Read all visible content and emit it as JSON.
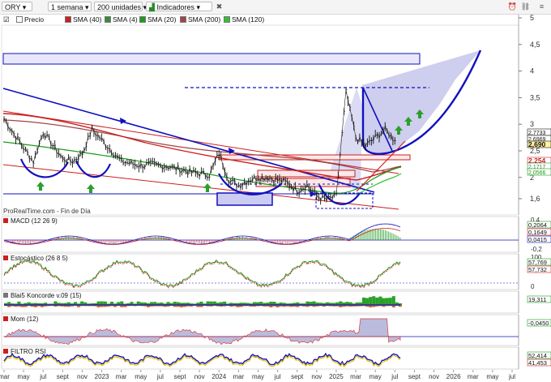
{
  "toolbar": {
    "ticker": "ORY",
    "timeframe": "1 semana",
    "units": "200 unidades",
    "indicators_btn": "Indicadores"
  },
  "legend": {
    "items": [
      "Precio",
      "SMA (40)",
      "SMA (4)",
      "SMA (20)",
      "SMA (200)",
      "SMA (120)"
    ]
  },
  "colors": {
    "price": "#111111",
    "sma40": "#cc1f1f",
    "sma4": "#3a8a3a",
    "sma20": "#1a9c1a",
    "sma200": "#a04646",
    "sma120": "#35c035",
    "trend_blue": "#1010c0",
    "cup_fill": "#b8b8e6"
  },
  "main": {
    "source_label": "ProRealTime.com - Fin de Día",
    "y_ticks": [
      "5",
      "4,5",
      "4",
      "3,5",
      "3",
      "2,5",
      "2",
      "1,6"
    ],
    "price_tags": [
      {
        "value": "2,7733",
        "color": "#111111"
      },
      {
        "value": "2,6969",
        "color": "#111111"
      },
      {
        "value": "2,690",
        "color": "#111111"
      },
      {
        "value": "2,254",
        "color": "#cc1f1f"
      },
      {
        "value": "2,1717",
        "color": "#3a8a3a"
      },
      {
        "value": "2,0566",
        "color": "#1a9c1a"
      }
    ]
  },
  "chart_data": [
    {
      "type": "line",
      "title": "ORY",
      "x_range": [
        "2022-03",
        "2026-07"
      ],
      "ylim": [
        1.5,
        5.1
      ],
      "grid": false,
      "series": [
        {
          "name": "Precio",
          "x": [
            "2022-03",
            "2022-05",
            "2022-06",
            "2022-07",
            "2022-08",
            "2022-09",
            "2022-10",
            "2022-11",
            "2022-12",
            "2023-01",
            "2023-03",
            "2023-05",
            "2023-06",
            "2023-08",
            "2023-10",
            "2023-12",
            "2024-01",
            "2024-02",
            "2024-03",
            "2024-04",
            "2024-05",
            "2024-06",
            "2024-07",
            "2024-08",
            "2024-09",
            "2024-10",
            "2024-11",
            "2024-12",
            "2025-01",
            "2025-02",
            "2025-03",
            "2025-04",
            "2025-05",
            "2025-06",
            "2025-07"
          ],
          "values": [
            3.1,
            2.55,
            2.3,
            2.85,
            2.6,
            2.35,
            2.3,
            2.45,
            2.9,
            2.7,
            2.3,
            2.22,
            2.25,
            2.2,
            2.1,
            2.05,
            2.45,
            1.95,
            1.85,
            1.95,
            2.0,
            2.0,
            1.95,
            1.9,
            1.75,
            1.85,
            1.65,
            1.58,
            1.65,
            3.6,
            2.75,
            2.6,
            2.75,
            2.9,
            2.69
          ]
        }
      ]
    },
    {
      "type": "bar",
      "title": "MACD (12 26 9)",
      "ylim": [
        -0.2,
        0.4
      ],
      "y_ticks": [
        "0,4",
        "-0,2"
      ],
      "tags": [
        "0,2064",
        "0,1649",
        "0,0415"
      ]
    },
    {
      "type": "line",
      "title": "Estocástico (26 8 5)",
      "ylim": [
        0,
        100
      ],
      "y_ticks": [
        "100",
        "0"
      ],
      "tags": [
        "57,769",
        "57,732"
      ]
    },
    {
      "type": "area",
      "title": "Blai5 Koncorde v.09 (15)",
      "tags": [
        "19,311"
      ]
    },
    {
      "type": "area",
      "title": "Mom (12)",
      "tags": [
        "-0,0450"
      ]
    },
    {
      "type": "line",
      "title": "FILTRO RSI",
      "tags": [
        "52,414",
        "41,453"
      ]
    }
  ],
  "x_axis": {
    "labels": [
      "mar",
      "may",
      "jul",
      "sept",
      "nov",
      "2023",
      "mar",
      "may",
      "jul",
      "sept",
      "nov",
      "2024",
      "mar",
      "may",
      "jul",
      "sept",
      "nov",
      "2025",
      "mar",
      "may",
      "jul",
      "sept",
      "nov",
      "2026",
      "mar",
      "may",
      "jul"
    ]
  }
}
